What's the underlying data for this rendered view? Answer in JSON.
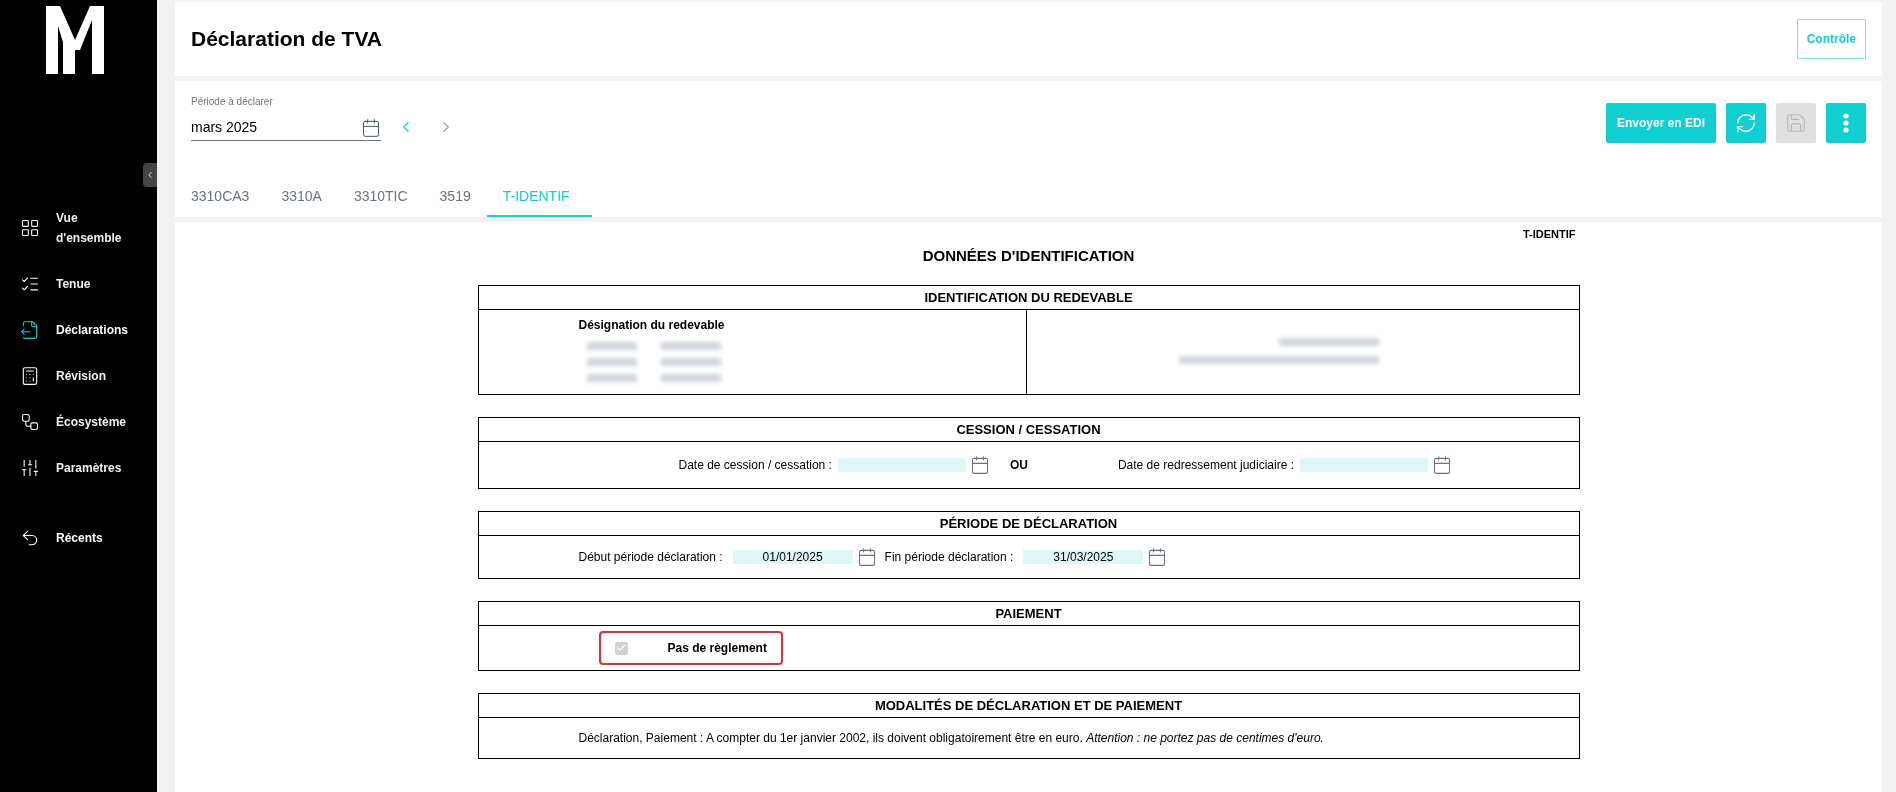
{
  "sidebar": {
    "items": [
      {
        "label": "Vue d'ensemble",
        "selected": false
      },
      {
        "label": "Tenue",
        "selected": false
      },
      {
        "label": "Déclarations",
        "selected": true
      },
      {
        "label": "Révision",
        "selected": false
      },
      {
        "label": "Écosystème",
        "selected": false
      },
      {
        "label": "Paramètres",
        "selected": false
      }
    ],
    "recent": {
      "label": "Récents"
    }
  },
  "header": {
    "title": "Déclaration de TVA",
    "control_button": "Contrôle"
  },
  "period": {
    "label": "Période à déclarer",
    "value": "mars 2025",
    "prev_disabled": false,
    "next_disabled": true
  },
  "actions": {
    "send_button": "Envoyer en EDI",
    "save_disabled": true
  },
  "tabs": [
    {
      "label": "3310CA3",
      "selected": false
    },
    {
      "label": "3310A",
      "selected": false
    },
    {
      "label": "3310TIC",
      "selected": false
    },
    {
      "label": "3519",
      "selected": false
    },
    {
      "label": "T-IDENTIF",
      "selected": true
    }
  ],
  "form": {
    "code": "T-IDENTIF",
    "title": "DONNÉES D'IDENTIFICATION",
    "sections": [
      {
        "kind": "identification",
        "title": "IDENTIFICATION DU REDEVABLE",
        "subtitle": "Désignation du redevable"
      },
      {
        "kind": "cession",
        "title": "CESSION / CESSATION",
        "fields": [
          {
            "label": "Date de cession / cessation :"
          },
          {
            "label": "Date de redressement judiciaire :"
          }
        ],
        "separator": "OU"
      },
      {
        "kind": "periode",
        "title": "PÉRIODE DE DÉCLARATION",
        "fields": [
          {
            "label": "Début période déclaration :",
            "value": "01/01/2025"
          },
          {
            "label": "Fin période déclaration :",
            "value": "31/03/2025"
          }
        ]
      },
      {
        "kind": "paiement",
        "title": "PAIEMENT",
        "checkbox": {
          "label": "Pas de règlement",
          "checked": true,
          "disabled": true,
          "highlighted": true
        }
      },
      {
        "kind": "modalites",
        "title": "MODALITÉS DE DÉCLARATION ET DE PAIEMENT",
        "text": "Déclaration, Paiement : A compter du 1er janvier 2002, ils doivent obligatoirement être en euro. *Attention : ne portez pas de centimes d'euro.*"
      }
    ]
  }
}
